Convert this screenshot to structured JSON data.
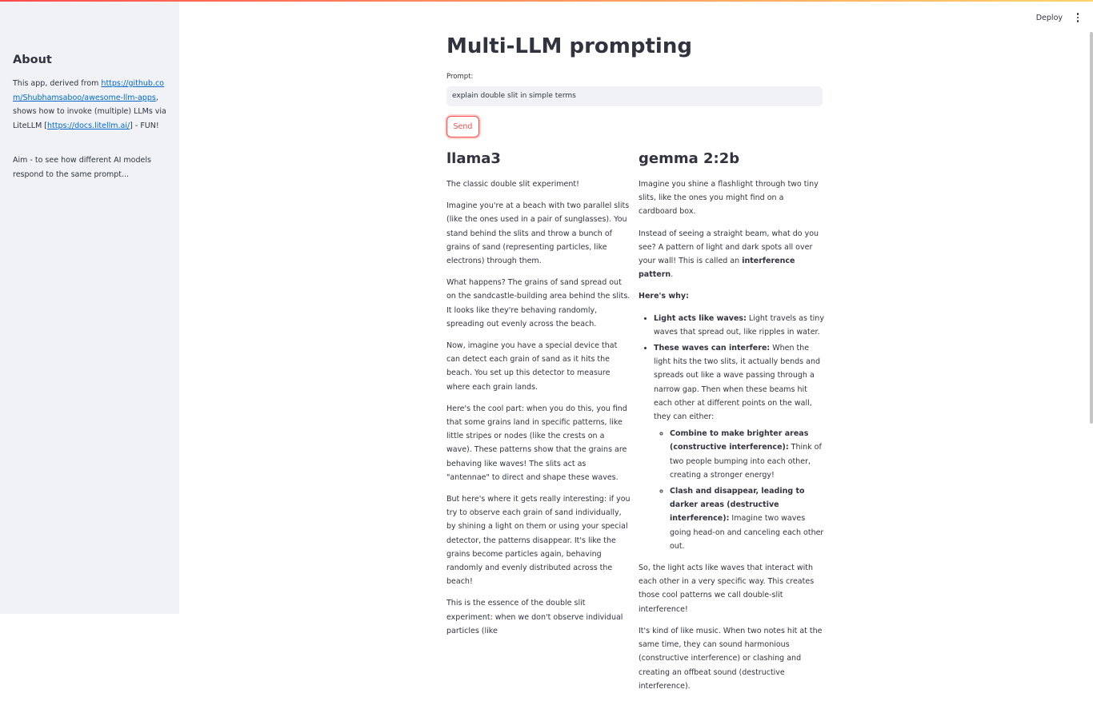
{
  "sidebar": {
    "title": "About",
    "p1_before": "This app, derived from ",
    "p1_link1": "https://github.com/Shubhamsaboo/awesome-llm-apps",
    "p1_middle": ", shows how to invoke (multiple) LLMs via LiteLLM [",
    "p1_link2": "https://docs.litellm.ai/",
    "p1_after": "] - FUN!",
    "p2": "Aim - to see how different AI models respond to the same prompt..."
  },
  "header": {
    "deploy_label": "Deploy",
    "menu_icon": "kebab-menu-icon"
  },
  "main": {
    "title": "Multi-LLM prompting",
    "prompt_label": "Prompt:",
    "prompt_value": "explain double slit in simple terms",
    "send_label": "Send"
  },
  "llama": {
    "heading": "llama3",
    "p1": "The classic double slit experiment!",
    "p2": "Imagine you're at a beach with two parallel slits (like the ones used in a pair of sunglasses). You stand behind the slits and throw a bunch of grains of sand (representing particles, like electrons) through them.",
    "p3": "What happens? The grains of sand spread out on the sandcastle-building area behind the slits. It looks like they're behaving randomly, spreading out evenly across the beach.",
    "p4": "Now, imagine you have a special device that can detect each grain of sand as it hits the beach. You set up this detector to measure where each grain lands.",
    "p5": "Here's the cool part: when you do this, you find that some grains land in specific patterns, like little stripes or nodes (like the crests on a wave). These patterns show that the grains are behaving like waves! The slits act as \"antennae\" to direct and shape these waves.",
    "p6": "But here's where it gets really interesting: if you try to observe each grain of sand individually, by shining a light on them or using your special detector, the patterns disappear. It's like the grains become particles again, behaving randomly and evenly distributed across the beach!",
    "p7": "This is the essence of the double slit experiment: when we don't observe individual particles (like"
  },
  "gemma": {
    "heading": "gemma 2:2b",
    "p1": "Imagine you shine a flashlight through two tiny slits, like the ones you might find on a cardboard box.",
    "p2_before": "Instead of seeing a straight beam, what do you see? A pattern of light and dark spots all over your wall! This is called an ",
    "p2_bold": "interference pattern",
    "p2_after": ".",
    "p3_bold": "Here's why:",
    "li1_bold": "Light acts like waves:",
    "li1_text": " Light travels as tiny waves that spread out, like ripples in water.",
    "li2_bold": "These waves can interfere:",
    "li2_text": " When the light hits the two slits, it actually bends and spreads out like a wave passing through a narrow gap. Then when these beams hit each other at different points on the wall, they can either:",
    "sub1_bold": "Combine to make brighter areas (constructive interference):",
    "sub1_text": " Think of two people bumping into each other, creating a stronger energy!",
    "sub2_bold": "Clash and disappear, leading to darker areas (destructive interference):",
    "sub2_text": " Imagine two waves going head-on and canceling each other out.",
    "p4": "So, the light acts like waves that interact with each other in a very specific way. This creates those cool patterns we call double-slit interference!",
    "p5": "It's kind of like music. When two notes hit at the same time, they can sound harmonious (constructive interference) or clashing and creating an offbeat sound (destructive interference)."
  },
  "colors": {
    "accent": "#ff4b4b",
    "sidebar_bg": "#f0f2f6",
    "link": "#0068c9",
    "text": "#31333f"
  }
}
